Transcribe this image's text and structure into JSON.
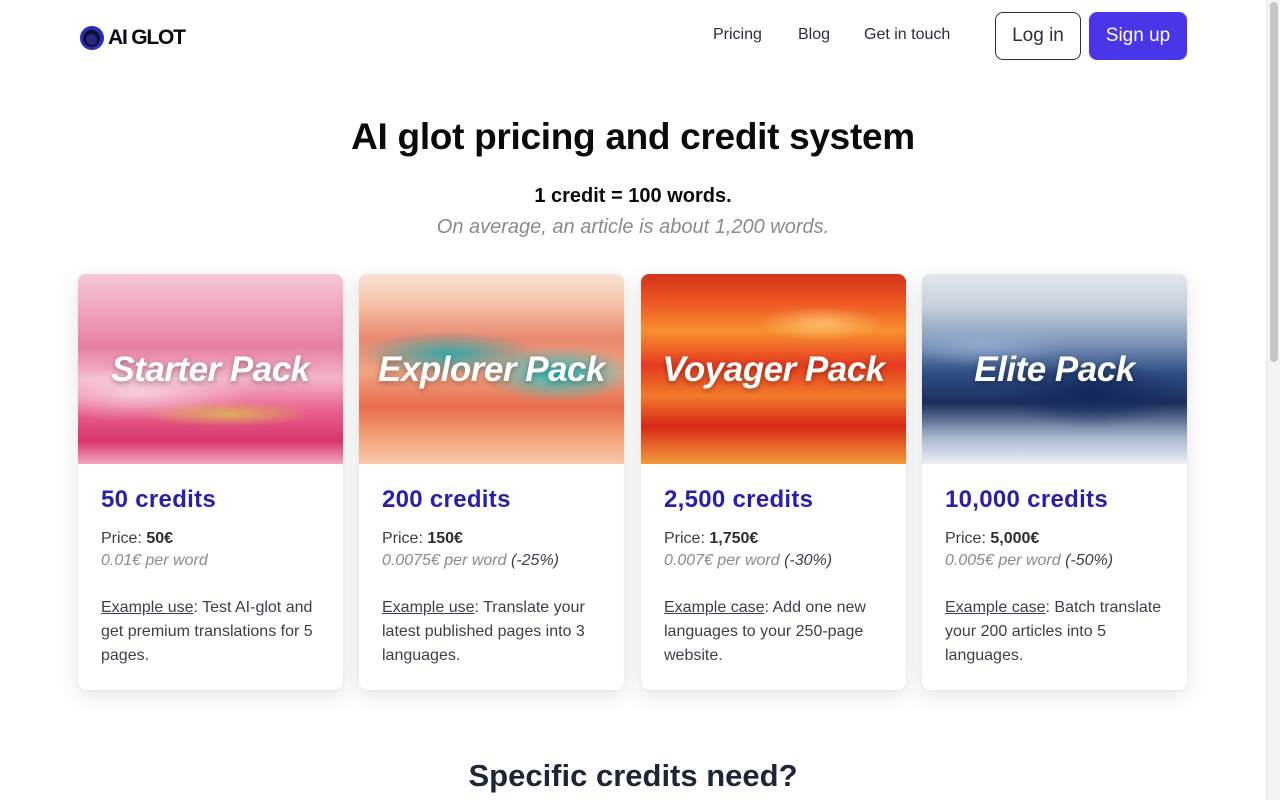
{
  "header": {
    "logo_text": "AI GLOT",
    "nav": {
      "pricing": "Pricing",
      "blog": "Blog",
      "contact": "Get in touch"
    },
    "login_label": "Log in",
    "signup_label": "Sign up"
  },
  "hero": {
    "title": "AI glot pricing and credit system",
    "subtitle": "1 credit = 100 words.",
    "note": "On average, an article is about 1,200 words."
  },
  "plans": [
    {
      "pack": "Starter Pack",
      "credits": "50 credits",
      "price_label": "Price: ",
      "price": "50€",
      "per_word": "0.01€ per word",
      "discount": "",
      "example_label": "Example use",
      "example_text": ": Test AI-glot and get premium translations for 5 pages."
    },
    {
      "pack": "Explorer Pack",
      "credits": "200 credits",
      "price_label": "Price: ",
      "price": "150€",
      "per_word": "0.0075€ per word",
      "discount": "(-25%)",
      "example_label": "Example use",
      "example_text": ": Translate your latest published pages into 3 languages."
    },
    {
      "pack": "Voyager Pack",
      "credits": "2,500 credits",
      "price_label": "Price: ",
      "price": "1,750€",
      "per_word": "0.007€ per word",
      "discount": "(-30%)",
      "example_label": "Example case",
      "example_text": ": Add one new languages to your 250-page website."
    },
    {
      "pack": "Elite Pack",
      "credits": "10,000 credits",
      "price_label": "Price: ",
      "price": "5,000€",
      "per_word": "0.005€ per word",
      "discount": "(-50%)",
      "example_label": "Example case",
      "example_text": ": Batch translate your 200 articles into 5 languages."
    }
  ],
  "specific_heading": "Specific credits need?",
  "colors": {
    "accent": "#4936e8",
    "credits_text": "#2a1fa8"
  }
}
